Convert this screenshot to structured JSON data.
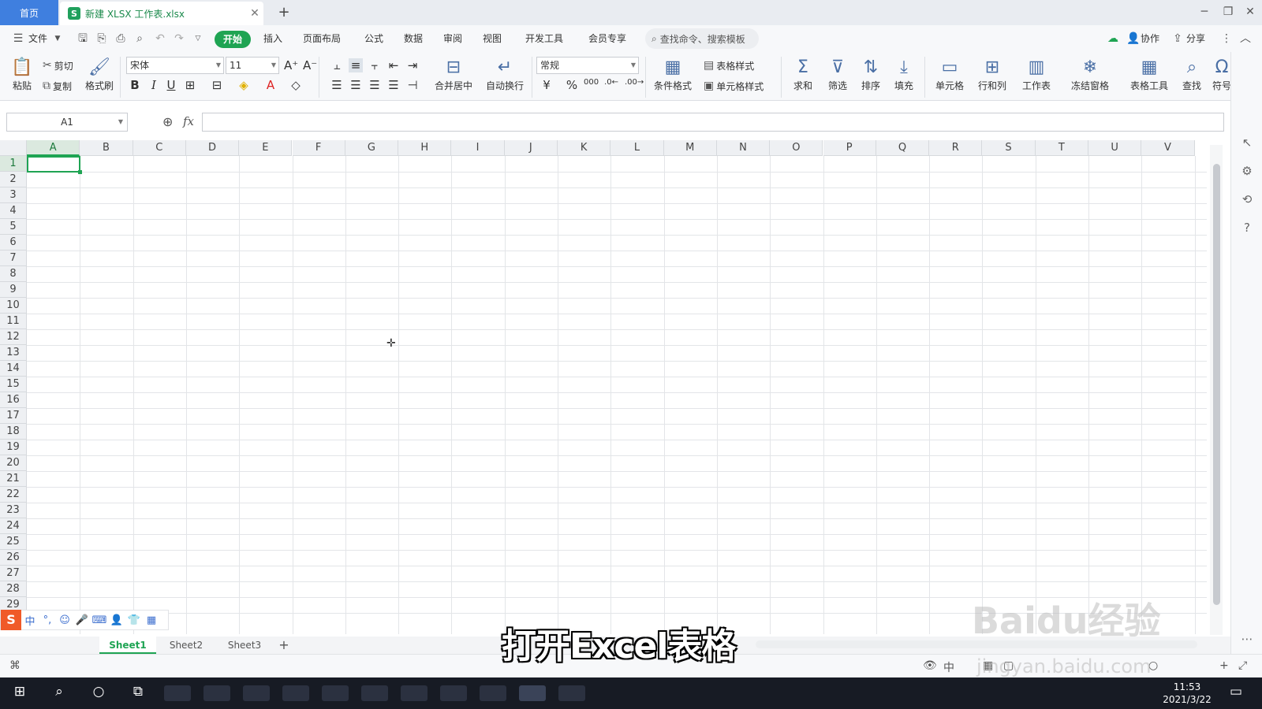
{
  "tabs": {
    "home": "首页",
    "document": "新建 XLSX 工作表.xlsx"
  },
  "menu": {
    "file": "文件",
    "start": "开始",
    "items": [
      "插入",
      "页面布局",
      "公式",
      "数据",
      "审阅",
      "视图",
      "开发工具",
      "会员专享"
    ],
    "search_placeholder": "查找命令、搜索模板",
    "collab": "协作",
    "share": "分享"
  },
  "ribbon": {
    "paste": "粘贴",
    "cut": "剪切",
    "copy": "复制",
    "format_painter": "格式刷",
    "font_name": "宋体",
    "font_size": "11",
    "merge_center": "合并居中",
    "wrap_text": "自动换行",
    "number_format": "常规",
    "conditional_format": "条件格式",
    "table_style": "表格样式",
    "cell_style": "单元格样式",
    "sum": "求和",
    "filter": "筛选",
    "sort": "排序",
    "fill": "填充",
    "cells": "单元格",
    "row_col": "行和列",
    "worksheet": "工作表",
    "freeze": "冻结窗格",
    "table_tools": "表格工具",
    "find": "查找",
    "symbol": "符号"
  },
  "formula_bar": {
    "name_box": "A1",
    "fx": "fx"
  },
  "columns": [
    "A",
    "B",
    "C",
    "D",
    "E",
    "F",
    "G",
    "H",
    "I",
    "J",
    "K",
    "L",
    "M",
    "N",
    "O",
    "P",
    "Q",
    "R",
    "S",
    "T",
    "U",
    "V"
  ],
  "rows": [
    "1",
    "2",
    "3",
    "4",
    "5",
    "6",
    "7",
    "8",
    "9",
    "10",
    "11",
    "12",
    "13",
    "14",
    "15",
    "16",
    "17",
    "18",
    "19",
    "20",
    "21",
    "22",
    "23",
    "24",
    "25",
    "26",
    "27",
    "28",
    "29"
  ],
  "sheets": [
    "Sheet1",
    "Sheet2",
    "Sheet3"
  ],
  "active_sheet": "Sheet1",
  "taskbar": {
    "time": "11:53",
    "date": "2021/3/22"
  },
  "subtitle": "打开Excel表格",
  "watermark": "Baidu经验",
  "watermark_url": "jingyan.baidu.com",
  "colors": {
    "accent": "#1fa453",
    "home_tab": "#3f7fdf",
    "taskbar": "#171b24"
  }
}
